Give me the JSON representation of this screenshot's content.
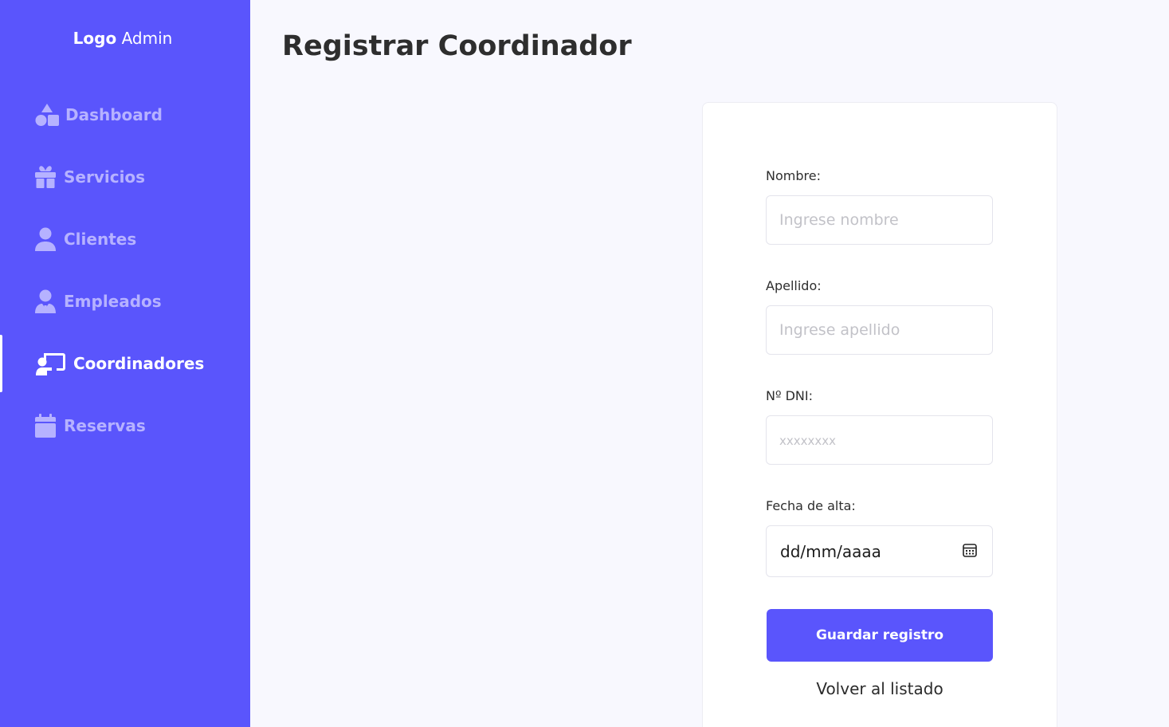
{
  "sidebar": {
    "logo_bold": "Logo",
    "logo_rest": " Admin",
    "items": [
      {
        "label": "Dashboard",
        "icon": "shapes-icon"
      },
      {
        "label": "Servicios",
        "icon": "gift-icon"
      },
      {
        "label": "Clientes",
        "icon": "user-icon"
      },
      {
        "label": "Empleados",
        "icon": "user-tie-icon"
      },
      {
        "label": "Coordinadores",
        "icon": "chalkboard-user-icon",
        "active": true
      },
      {
        "label": "Reservas",
        "icon": "calendar-icon"
      }
    ],
    "accent_color": "#5a55fc"
  },
  "main": {
    "title": "Registrar Coordinador"
  },
  "form": {
    "nombre_label": "Nombre:",
    "nombre_placeholder": "Ingrese nombre",
    "apellido_label": "Apellido:",
    "apellido_placeholder": "Ingrese apellido",
    "dni_label": "Nº DNI:",
    "dni_placeholder": "xxxxxxxx",
    "fecha_label": "Fecha de alta:",
    "fecha_placeholder": "dd/mm/aaaa",
    "save_label": "Guardar registro",
    "back_label": "Volver al listado"
  }
}
